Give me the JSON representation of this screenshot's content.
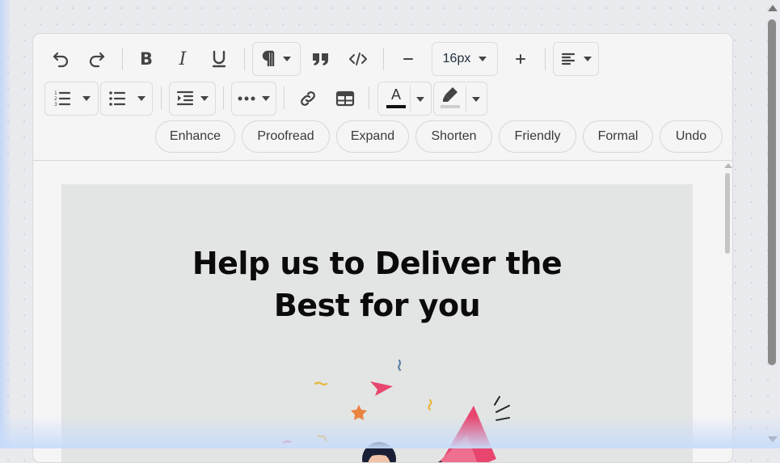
{
  "toolbar": {
    "font_size": "16px",
    "ai_actions": [
      "Enhance",
      "Proofread",
      "Expand",
      "Shorten",
      "Friendly",
      "Formal",
      "Undo"
    ],
    "text_color_letter": "A",
    "text_color": "#111111",
    "highlight_color": "#cfcfcf"
  },
  "content": {
    "headline_line1": "Help us to Deliver the",
    "headline_line2": "Best for you",
    "background": "#e3e5e4"
  },
  "colors": {
    "accent_pink": "#e8466f",
    "icon": "#222f3e"
  }
}
